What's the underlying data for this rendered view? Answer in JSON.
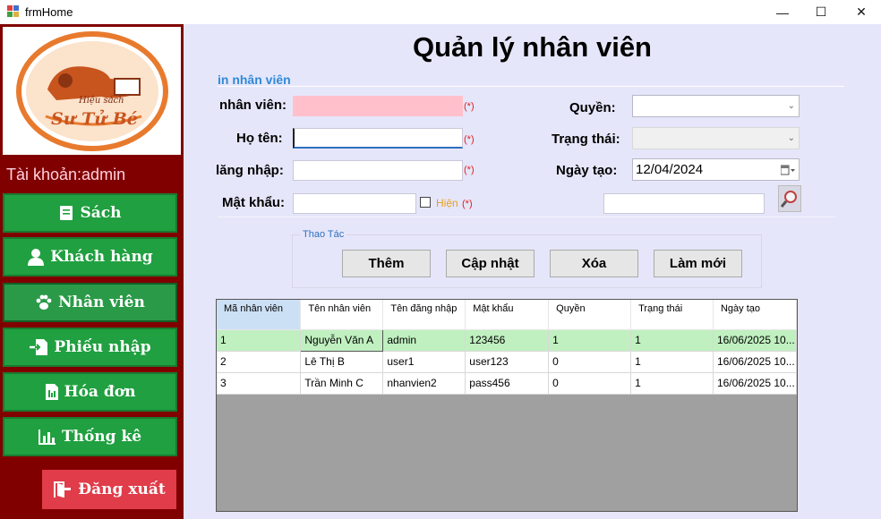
{
  "window": {
    "title": "frmHome",
    "minimize": "—",
    "maximize": "☐",
    "close": "✕"
  },
  "sidebar": {
    "logo_text_top": "Hiệu sách",
    "logo_text_main": "Sư Tử Bé",
    "account": "Tài khoản:admin",
    "items": [
      {
        "label": "Sách",
        "icon": "book-icon"
      },
      {
        "label": "Khách hàng",
        "icon": "user-icon"
      },
      {
        "label": "Nhân viên",
        "icon": "paw-icon"
      },
      {
        "label": "Phiếu nhập",
        "icon": "import-file-icon"
      },
      {
        "label": "Hóa đơn",
        "icon": "invoice-icon"
      },
      {
        "label": "Thống kê",
        "icon": "bar-chart-icon"
      }
    ],
    "logout": "Đăng xuất"
  },
  "main": {
    "title": "Quản lý nhân viên",
    "group_label": "in nhân viên",
    "form": {
      "id_label": "nhân viên:",
      "name_label": "Họ tên:",
      "username_label": "lăng nhập:",
      "password_label": "Mật khẩu:",
      "role_label": "Quyền:",
      "status_label": "Trạng thái:",
      "created_label": "Ngày tạo:",
      "created_value": "12/04/2024",
      "show_password_label": "Hiện",
      "required": "(*)"
    },
    "toolbox_label": "Thao Tác",
    "actions": {
      "add": "Thêm",
      "update": "Cập nhật",
      "delete": "Xóa",
      "refresh": "Làm mới"
    },
    "grid": {
      "columns": [
        "Mã nhân viên",
        "Tên nhân viên",
        "Tên đăng nhập",
        "Mật khẩu",
        "Quyền",
        "Trạng thái",
        "Ngày tạo"
      ],
      "rows": [
        [
          "1",
          "Nguyễn Văn A",
          "admin",
          "123456",
          "1",
          "1",
          "16/06/2025 10..."
        ],
        [
          "2",
          "Lê Thị B",
          "user1",
          "user123",
          "0",
          "1",
          "16/06/2025 10..."
        ],
        [
          "3",
          "Trần Minh C",
          "nhanvien2",
          "pass456",
          "0",
          "1",
          "16/06/2025 10..."
        ]
      ]
    }
  },
  "colors": {
    "sidebar": "#800000",
    "main_bg": "#e6e6fa",
    "nav_green": "#20a040",
    "logout_red": "#e03c4a"
  }
}
